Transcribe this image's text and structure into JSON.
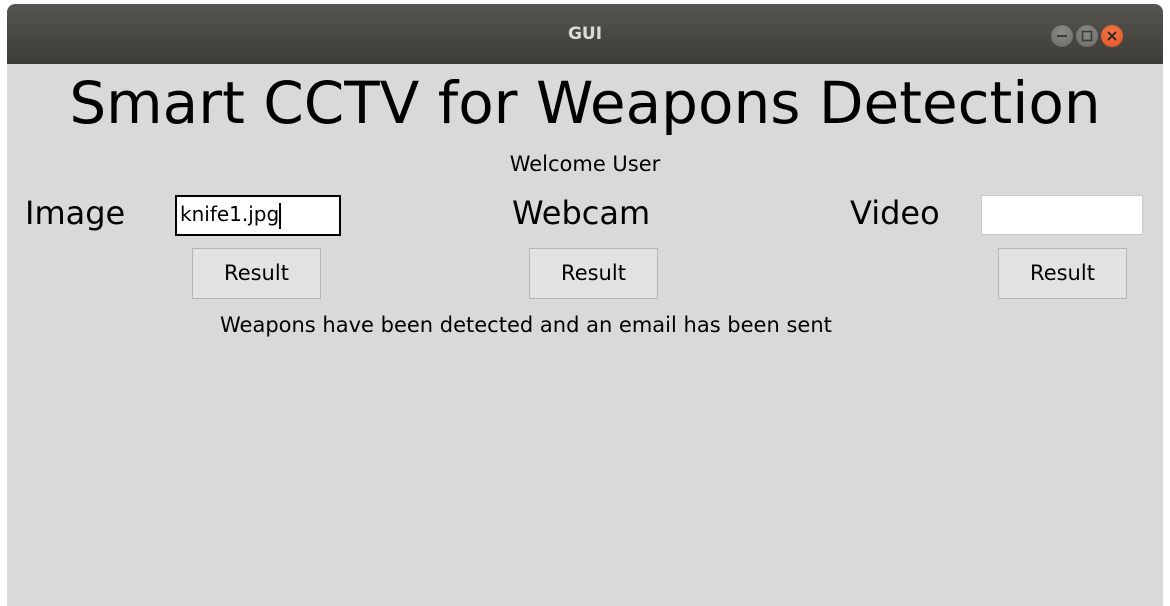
{
  "window": {
    "title": "GUI",
    "controls": [
      "minimize-icon",
      "maximize-icon",
      "close-icon"
    ],
    "colors": {
      "titlebar": "#45443f",
      "close": "#e95420",
      "background": "#d9d9d9"
    }
  },
  "main": {
    "title": "Smart CCTV for Weapons Detection",
    "welcome": "Welcome User",
    "image": {
      "label": "Image",
      "value": "knife1.jpg",
      "result_label": "Result"
    },
    "webcam": {
      "label": "Webcam",
      "result_label": "Result"
    },
    "video": {
      "label": "Video",
      "value": "",
      "result_label": "Result"
    },
    "status": "Weapons have been detected and an email has been sent"
  }
}
